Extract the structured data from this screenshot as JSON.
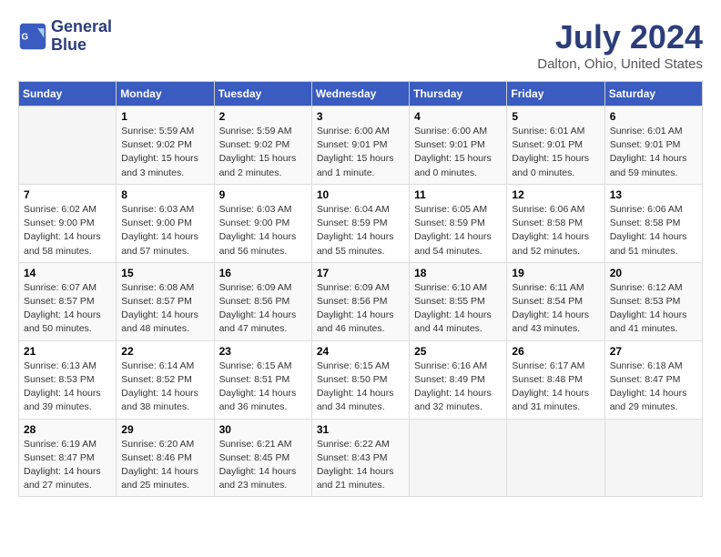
{
  "header": {
    "logo_line1": "General",
    "logo_line2": "Blue",
    "title": "July 2024",
    "subtitle": "Dalton, Ohio, United States"
  },
  "columns": [
    "Sunday",
    "Monday",
    "Tuesday",
    "Wednesday",
    "Thursday",
    "Friday",
    "Saturday"
  ],
  "weeks": [
    [
      {
        "day": "",
        "info": ""
      },
      {
        "day": "1",
        "info": "Sunrise: 5:59 AM\nSunset: 9:02 PM\nDaylight: 15 hours\nand 3 minutes."
      },
      {
        "day": "2",
        "info": "Sunrise: 5:59 AM\nSunset: 9:02 PM\nDaylight: 15 hours\nand 2 minutes."
      },
      {
        "day": "3",
        "info": "Sunrise: 6:00 AM\nSunset: 9:01 PM\nDaylight: 15 hours\nand 1 minute."
      },
      {
        "day": "4",
        "info": "Sunrise: 6:00 AM\nSunset: 9:01 PM\nDaylight: 15 hours\nand 0 minutes."
      },
      {
        "day": "5",
        "info": "Sunrise: 6:01 AM\nSunset: 9:01 PM\nDaylight: 15 hours\nand 0 minutes."
      },
      {
        "day": "6",
        "info": "Sunrise: 6:01 AM\nSunset: 9:01 PM\nDaylight: 14 hours\nand 59 minutes."
      }
    ],
    [
      {
        "day": "7",
        "info": "Sunrise: 6:02 AM\nSunset: 9:00 PM\nDaylight: 14 hours\nand 58 minutes."
      },
      {
        "day": "8",
        "info": "Sunrise: 6:03 AM\nSunset: 9:00 PM\nDaylight: 14 hours\nand 57 minutes."
      },
      {
        "day": "9",
        "info": "Sunrise: 6:03 AM\nSunset: 9:00 PM\nDaylight: 14 hours\nand 56 minutes."
      },
      {
        "day": "10",
        "info": "Sunrise: 6:04 AM\nSunset: 8:59 PM\nDaylight: 14 hours\nand 55 minutes."
      },
      {
        "day": "11",
        "info": "Sunrise: 6:05 AM\nSunset: 8:59 PM\nDaylight: 14 hours\nand 54 minutes."
      },
      {
        "day": "12",
        "info": "Sunrise: 6:06 AM\nSunset: 8:58 PM\nDaylight: 14 hours\nand 52 minutes."
      },
      {
        "day": "13",
        "info": "Sunrise: 6:06 AM\nSunset: 8:58 PM\nDaylight: 14 hours\nand 51 minutes."
      }
    ],
    [
      {
        "day": "14",
        "info": "Sunrise: 6:07 AM\nSunset: 8:57 PM\nDaylight: 14 hours\nand 50 minutes."
      },
      {
        "day": "15",
        "info": "Sunrise: 6:08 AM\nSunset: 8:57 PM\nDaylight: 14 hours\nand 48 minutes."
      },
      {
        "day": "16",
        "info": "Sunrise: 6:09 AM\nSunset: 8:56 PM\nDaylight: 14 hours\nand 47 minutes."
      },
      {
        "day": "17",
        "info": "Sunrise: 6:09 AM\nSunset: 8:56 PM\nDaylight: 14 hours\nand 46 minutes."
      },
      {
        "day": "18",
        "info": "Sunrise: 6:10 AM\nSunset: 8:55 PM\nDaylight: 14 hours\nand 44 minutes."
      },
      {
        "day": "19",
        "info": "Sunrise: 6:11 AM\nSunset: 8:54 PM\nDaylight: 14 hours\nand 43 minutes."
      },
      {
        "day": "20",
        "info": "Sunrise: 6:12 AM\nSunset: 8:53 PM\nDaylight: 14 hours\nand 41 minutes."
      }
    ],
    [
      {
        "day": "21",
        "info": "Sunrise: 6:13 AM\nSunset: 8:53 PM\nDaylight: 14 hours\nand 39 minutes."
      },
      {
        "day": "22",
        "info": "Sunrise: 6:14 AM\nSunset: 8:52 PM\nDaylight: 14 hours\nand 38 minutes."
      },
      {
        "day": "23",
        "info": "Sunrise: 6:15 AM\nSunset: 8:51 PM\nDaylight: 14 hours\nand 36 minutes."
      },
      {
        "day": "24",
        "info": "Sunrise: 6:15 AM\nSunset: 8:50 PM\nDaylight: 14 hours\nand 34 minutes."
      },
      {
        "day": "25",
        "info": "Sunrise: 6:16 AM\nSunset: 8:49 PM\nDaylight: 14 hours\nand 32 minutes."
      },
      {
        "day": "26",
        "info": "Sunrise: 6:17 AM\nSunset: 8:48 PM\nDaylight: 14 hours\nand 31 minutes."
      },
      {
        "day": "27",
        "info": "Sunrise: 6:18 AM\nSunset: 8:47 PM\nDaylight: 14 hours\nand 29 minutes."
      }
    ],
    [
      {
        "day": "28",
        "info": "Sunrise: 6:19 AM\nSunset: 8:47 PM\nDaylight: 14 hours\nand 27 minutes."
      },
      {
        "day": "29",
        "info": "Sunrise: 6:20 AM\nSunset: 8:46 PM\nDaylight: 14 hours\nand 25 minutes."
      },
      {
        "day": "30",
        "info": "Sunrise: 6:21 AM\nSunset: 8:45 PM\nDaylight: 14 hours\nand 23 minutes."
      },
      {
        "day": "31",
        "info": "Sunrise: 6:22 AM\nSunset: 8:43 PM\nDaylight: 14 hours\nand 21 minutes."
      },
      {
        "day": "",
        "info": ""
      },
      {
        "day": "",
        "info": ""
      },
      {
        "day": "",
        "info": ""
      }
    ]
  ]
}
